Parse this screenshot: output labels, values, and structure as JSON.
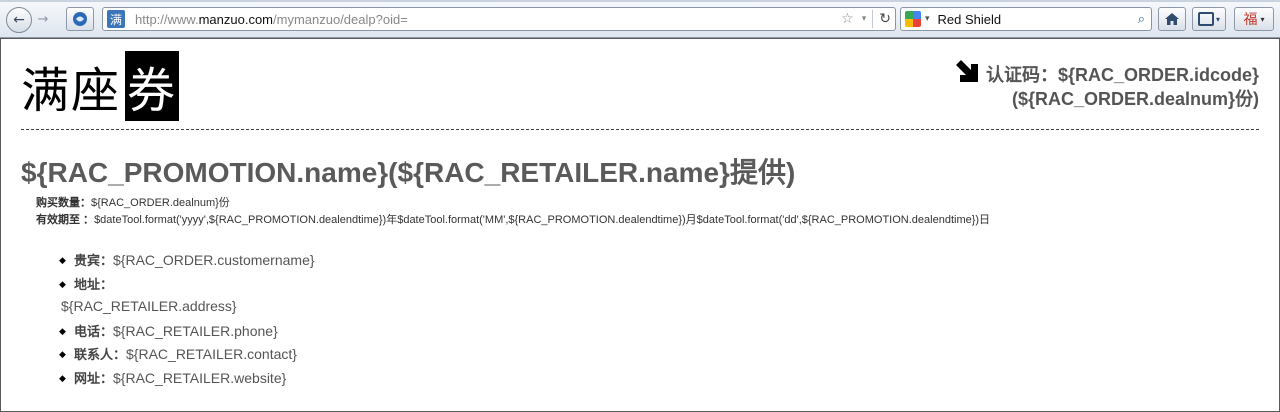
{
  "browser": {
    "url_scheme": "http://www.",
    "url_host": "manzuo.com",
    "url_path": "/mymanzuo/dealp?oid=",
    "site_icon": "满",
    "search_engine": "Red Shield"
  },
  "page": {
    "brand_prefix": "满座",
    "brand_highlight": "券",
    "code_line1": "认证码：${RAC_ORDER.idcode}",
    "code_line2": "(${RAC_ORDER.dealnum}份)",
    "title": "${RAC_PROMOTION.name}(${RAC_RETAILER.name}提供)",
    "quantity_label": "购买数量：",
    "quantity_value": "${RAC_ORDER.dealnum}份",
    "validity_label": "有效期至 ：",
    "validity_value": "$dateTool.format('yyyy',${RAC_PROMOTION.dealendtime})年$dateTool.format('MM',${RAC_PROMOTION.dealendtime})月$dateTool.format('dd',${RAC_PROMOTION.dealendtime})日",
    "guest_label": "贵宾：",
    "guest_value": "${RAC_ORDER.customername}",
    "address_label": "地址：",
    "address_value": "${RAC_RETAILER.address}",
    "phone_label": "电话：",
    "phone_value": "${RAC_RETAILER.phone}",
    "contact_label": "联系人：",
    "contact_value": "${RAC_RETAILER.contact}",
    "website_label": "网址：",
    "website_value": "${RAC_RETAILER.website}"
  }
}
